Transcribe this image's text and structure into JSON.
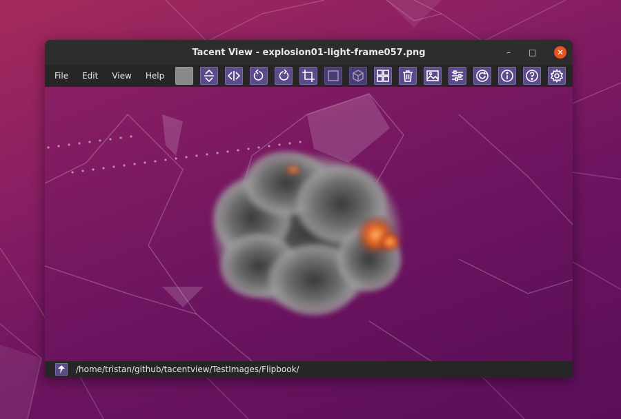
{
  "window": {
    "title": "Tacent View - explosion01-light-frame057.png",
    "minimize_glyph": "–",
    "maximize_glyph": "□",
    "close_glyph": "✕"
  },
  "menu": [
    "File",
    "Edit",
    "View",
    "Help"
  ],
  "toolbar": [
    {
      "name": "background-color-swatch",
      "icon": "gray-square"
    },
    {
      "name": "flip-vertical-button",
      "icon": "flip-vertical-icon"
    },
    {
      "name": "flip-horizontal-button",
      "icon": "flip-horizontal-icon"
    },
    {
      "name": "rotate-ccw-button",
      "icon": "rotate-ccw-icon"
    },
    {
      "name": "rotate-cw-button",
      "icon": "rotate-cw-icon"
    },
    {
      "name": "crop-button",
      "icon": "crop-icon"
    },
    {
      "name": "image-mode-button",
      "icon": "square-icon",
      "disabled": true
    },
    {
      "name": "cubemap-button",
      "icon": "cube-icon",
      "disabled": true
    },
    {
      "name": "thumbnail-grid-button",
      "icon": "grid-icon"
    },
    {
      "name": "delete-button",
      "icon": "trash-icon"
    },
    {
      "name": "image-info-button",
      "icon": "picture-icon"
    },
    {
      "name": "adjustments-button",
      "icon": "sliders-icon"
    },
    {
      "name": "refresh-button",
      "icon": "refresh-icon"
    },
    {
      "name": "info-button",
      "icon": "info-icon"
    },
    {
      "name": "help-button",
      "icon": "help-icon"
    },
    {
      "name": "settings-button",
      "icon": "gear-icon"
    }
  ],
  "status": {
    "path": "/home/tristan/github/tacentview/TestImages/Flipbook/"
  },
  "colors": {
    "accent": "#e95420",
    "button": "#5c4a8a",
    "button_border": "#7a6aa8"
  }
}
